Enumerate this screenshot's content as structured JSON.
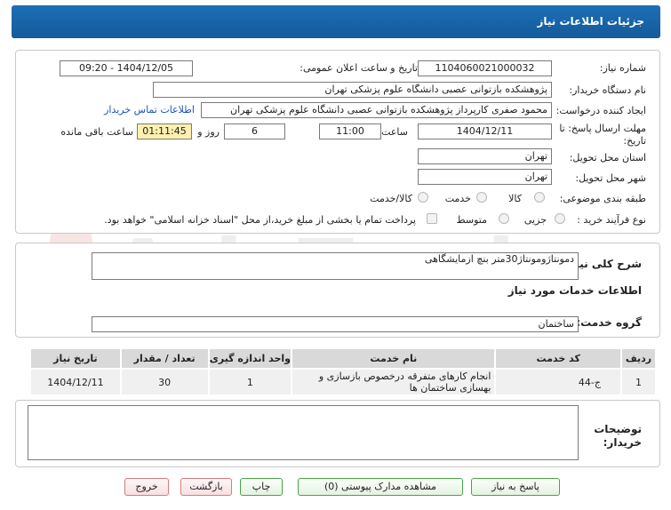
{
  "header": {
    "title": "جزئیات اطلاعات نیاز"
  },
  "form": {
    "need_number_label": "شماره نیاز:",
    "need_number": "1104060021000032",
    "announce_label": "تاریخ و ساعت اعلان عمومی:",
    "announce_value": "1404/12/05 - 09:20",
    "buyer_label": "نام دستگاه خریدار:",
    "buyer_value": "پژوهشکده بازتوانی عصبی دانشگاه علوم پزشکی تهران",
    "creator_label": "ایجاد کننده درخواست:",
    "creator_value": "محمود صفری کارپرداز پژوهشکده بازتوانی عصبی دانشگاه علوم پزشکی تهران",
    "contact_link": "اطلاعات تماس خریدار",
    "deadline_label_line1": "مهلت ارسال پاسخ: تا",
    "deadline_label_line2": "تاریخ:",
    "deadline_date": "1404/12/11",
    "time_label": "ساعت",
    "deadline_time": "11:00",
    "days_value": "6",
    "days_label": "روز و",
    "remaining_value": "01:11:45",
    "remaining_label": "ساعت باقی مانده",
    "province_label": "استان محل تحویل:",
    "province_value": "تهران",
    "city_label": "شهر محل تحویل:",
    "city_value": "تهران",
    "category_label": "طبقه بندی موضوعی:",
    "category_options": [
      "کالا",
      "خدمت",
      "کالا/خدمت"
    ],
    "process_label": "نوع فرآیند خرید :",
    "process_options": [
      "جزیی",
      "متوسط"
    ],
    "payment_note": "پرداخت تمام یا بخشی از مبلغ خرید،از محل \"اسناد خزانه اسلامی\" خواهد بود."
  },
  "description": {
    "label": "شرح کلی نیاز:",
    "value": "دمونتاژومونتاژ30متر بنچ ازمایشگاهی"
  },
  "services": {
    "section_title": "اطلاعات خدمات مورد نیاز",
    "group_label": "گروه خدمت:",
    "group_value": "ساختمان",
    "columns": [
      "ردیف",
      "کد خدمت",
      "نام خدمت",
      "واحد اندازه گیری",
      "تعداد / مقدار",
      "تاریخ نیاز"
    ],
    "rows": [
      [
        "1",
        "ج-44",
        "انجام کارهای متفرقه درخصوص بازسازی و بهسازی ساختمان ها",
        "1",
        "30",
        "1404/12/11"
      ]
    ]
  },
  "buyer_notes": {
    "label_line1": "توضیحات",
    "label_line2": "خریدار:",
    "value": ""
  },
  "buttons": {
    "reply": "پاسخ به نیاز",
    "docs": "مشاهده مدارک پیوستی (0)",
    "print": "چاپ",
    "back": "بازگشت",
    "exit": "خروج"
  },
  "watermark": {
    "text": "AriaTender.net"
  }
}
